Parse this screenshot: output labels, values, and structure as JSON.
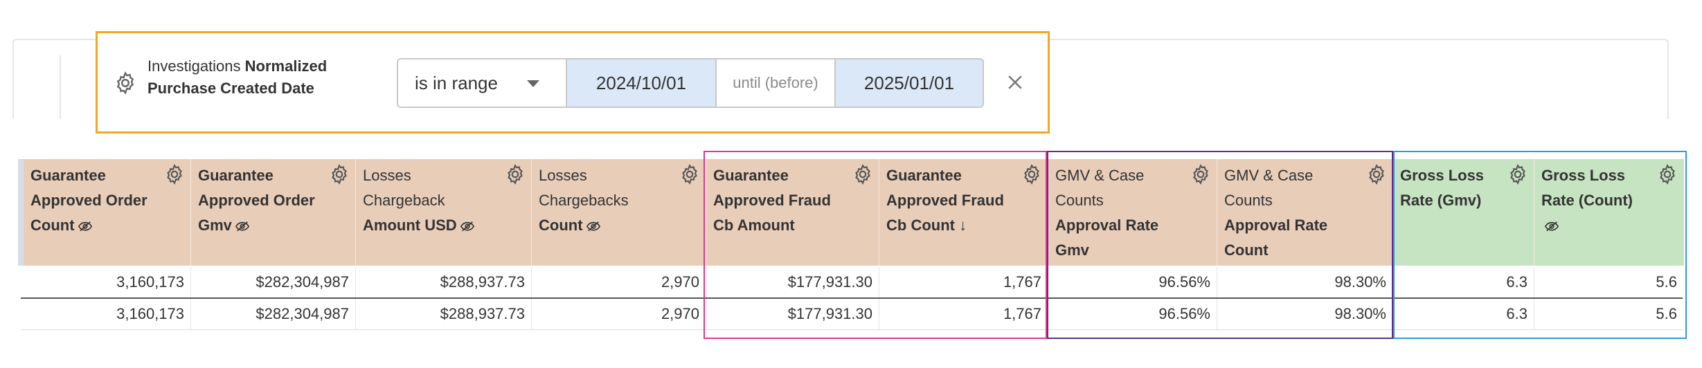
{
  "filter": {
    "label_prefix": "Investigations ",
    "label_bold": "Normalized Purchase Created Date",
    "operator": "is in range",
    "start_date": "2024/10/01",
    "until_text": "until (before)",
    "end_date": "2025/01/01"
  },
  "columns": [
    {
      "line1": "Guarantee",
      "line2": "Approved Order",
      "line3": "Count",
      "bold_all": true,
      "hidden_icon": true,
      "sort_icon": false,
      "color": "tan"
    },
    {
      "line1": "Guarantee",
      "line2": "Approved Order",
      "line3": "Gmv",
      "bold_all": true,
      "hidden_icon": true,
      "sort_icon": false,
      "color": "tan"
    },
    {
      "line1": "Losses",
      "line2": "Chargeback",
      "line3": "Amount USD",
      "bold_all": false,
      "hidden_icon": true,
      "sort_icon": false,
      "color": "tan"
    },
    {
      "line1": "Losses",
      "line2": "Chargebacks",
      "line3": "Count",
      "bold_all": false,
      "hidden_icon": true,
      "sort_icon": false,
      "color": "tan"
    },
    {
      "line1": "Guarantee",
      "line2": "Approved Fraud",
      "line3": "Cb Amount",
      "bold_all": true,
      "hidden_icon": false,
      "sort_icon": false,
      "color": "tan"
    },
    {
      "line1": "Guarantee",
      "line2": "Approved Fraud",
      "line3": "Cb Count",
      "bold_all": true,
      "hidden_icon": false,
      "sort_icon": true,
      "color": "tan"
    },
    {
      "line1": "GMV & Case",
      "line2": "Counts",
      "line3": "Approval Rate",
      "line4": "Gmv",
      "bold_all": false,
      "hidden_icon": false,
      "sort_icon": false,
      "color": "tan"
    },
    {
      "line1": "GMV & Case",
      "line2": "Counts",
      "line3": "Approval Rate",
      "line4": "Count",
      "bold_all": false,
      "hidden_icon": false,
      "sort_icon": false,
      "color": "tan"
    },
    {
      "line1": "Gross Loss",
      "line2": "Rate (Gmv)",
      "bold_all": true,
      "hidden_icon": false,
      "sort_icon": false,
      "color": "green"
    },
    {
      "line1": "Gross Loss",
      "line2": "Rate (Count)",
      "bold_all": true,
      "hidden_icon": true,
      "sort_icon": false,
      "color": "green"
    }
  ],
  "rows": [
    [
      "3,160,173",
      "$282,304,987",
      "$288,937.73",
      "2,970",
      "$177,931.30",
      "1,767",
      "96.56%",
      "98.30%",
      "6.3",
      "5.6"
    ],
    [
      "3,160,173",
      "$282,304,987",
      "$288,937.73",
      "2,970",
      "$177,931.30",
      "1,767",
      "96.56%",
      "98.30%",
      "6.3",
      "5.6"
    ]
  ],
  "sort_arrow": "↓",
  "colors": {
    "header_tan": "#e8cdb9",
    "header_green": "#c6e4c1",
    "filter_outline": "#f5a623",
    "box_pink": "#e0388c",
    "box_purple": "#5b2d8e",
    "box_blue": "#2b9be0",
    "date_fill": "#dbe8f8"
  }
}
